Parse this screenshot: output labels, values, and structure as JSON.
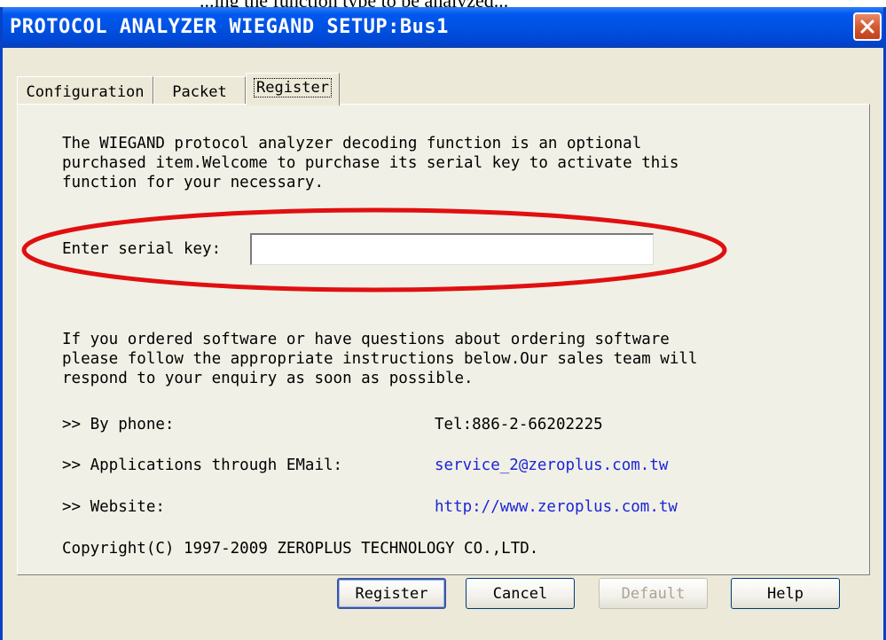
{
  "above_text": "...ing the function type to be analyzed...",
  "window": {
    "title": "PROTOCOL ANALYZER WIEGAND SETUP:Bus1",
    "close_icon": "close-x-icon",
    "titlebar_color": "#0054e3",
    "close_color": "#d4562f"
  },
  "tabs": [
    {
      "label": "Configuration",
      "active": false
    },
    {
      "label": "Packet",
      "active": false
    },
    {
      "label": "Register",
      "active": true
    }
  ],
  "register": {
    "intro_lines": [
      "The WIEGAND protocol analyzer decoding function is an optional",
      "purchased item.Welcome to purchase its serial key to activate this",
      "function for your necessary."
    ],
    "serial_label": "Enter serial key:",
    "serial_value": "",
    "highlight_color": "#e01010",
    "info_lines": [
      "If you ordered software or have questions about ordering software",
      "please follow the appropriate instructions below.Our sales team will",
      "respond to your enquiry as soon as possible."
    ],
    "contacts": [
      {
        "label": ">> By phone:",
        "value": "Tel:886-2-66202225",
        "is_link": false
      },
      {
        "label": ">> Applications through EMail:",
        "value": "service_2@zeroplus.com.tw",
        "is_link": true
      },
      {
        "label": ">> Website:",
        "value": "http://www.zeroplus.com.tw",
        "is_link": true
      }
    ],
    "copyright": "Copyright(C) 1997-2009 ZEROPLUS TECHNOLOGY CO.,LTD."
  },
  "buttons": {
    "register": "Register",
    "cancel": "Cancel",
    "default": "Default",
    "help": "Help",
    "default_disabled": true
  },
  "colors": {
    "link": "#1a25d8",
    "dialog_bg": "#ece9d8"
  }
}
